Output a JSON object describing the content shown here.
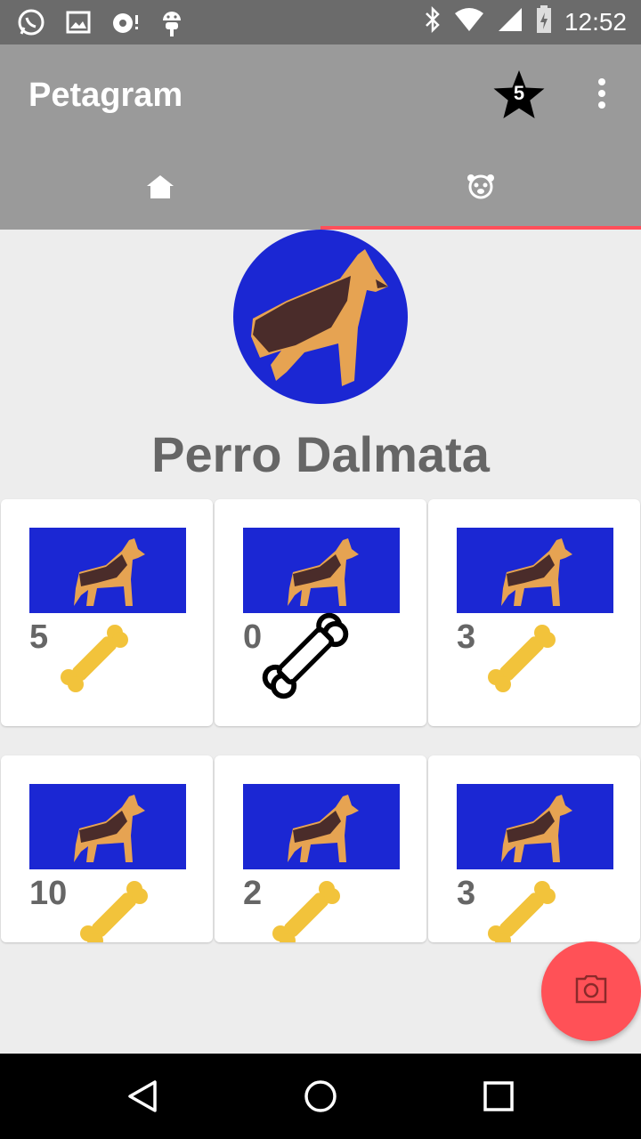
{
  "status_bar": {
    "time": "12:52",
    "left_icons": [
      "whatsapp-icon",
      "image-icon",
      "camera-icon",
      "android-icon"
    ],
    "right_icons": [
      "bluetooth-icon",
      "wifi-icon",
      "signal-icon",
      "battery-charging-icon"
    ]
  },
  "app_bar": {
    "title": "Petagram",
    "favorites_count": "5",
    "icons": [
      "star-icon",
      "overflow-menu-icon"
    ]
  },
  "tabs": [
    {
      "icon": "home-icon",
      "selected": false
    },
    {
      "icon": "dog-face-icon",
      "selected": true
    }
  ],
  "profile": {
    "name": "Perro Dalmata"
  },
  "photos": [
    {
      "likes": "5",
      "bone": "filled"
    },
    {
      "likes": "0",
      "bone": "outline"
    },
    {
      "likes": "3",
      "bone": "filled"
    },
    {
      "likes": "10",
      "bone": "filled"
    },
    {
      "likes": "2",
      "bone": "filled"
    },
    {
      "likes": "3",
      "bone": "filled"
    }
  ],
  "fab": {
    "icon": "camera-icon"
  },
  "nav_bar": {
    "icons": [
      "back-icon",
      "home-icon",
      "recents-icon"
    ]
  },
  "colors": {
    "app_bar": "#9a9a9a",
    "status_bar": "#6b6b6b",
    "accent": "#ff4f5a",
    "photo_background": "#1b27d3",
    "bone": "#f2c33b"
  }
}
